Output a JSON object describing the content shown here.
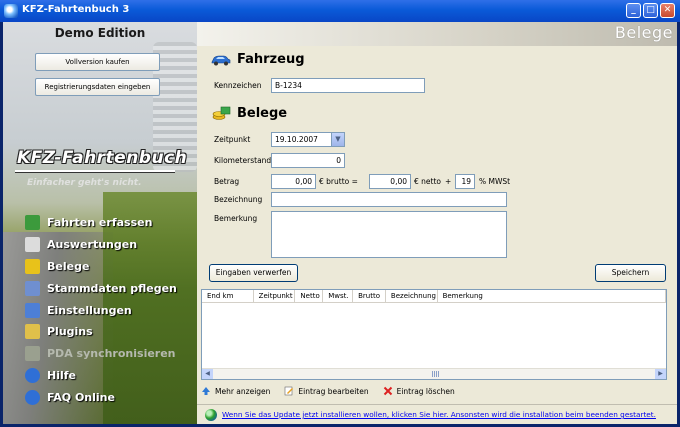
{
  "window": {
    "title": "KFZ-Fahrtenbuch 3",
    "minimize": "_",
    "maximize": "□",
    "close": "✕"
  },
  "sidebar": {
    "edition": "Demo Edition",
    "buy_button": "Vollversion kaufen",
    "register_button": "Registrierungsdaten eingeben",
    "brand": "KFZ-Fahrtenbuch",
    "tagline": "Einfacher geht's nicht.",
    "items": [
      {
        "label": "Fahrten erfassen",
        "icon": "logbook-icon",
        "color": "#3c9a3c"
      },
      {
        "label": "Auswertungen",
        "icon": "printer-icon",
        "color": "#dcdcdc"
      },
      {
        "label": "Belege",
        "icon": "coins-icon",
        "color": "#e8c21a"
      },
      {
        "label": "Stammdaten pflegen",
        "icon": "calendar-icon",
        "color": "#6f8fd0"
      },
      {
        "label": "Einstellungen",
        "icon": "checklist-icon",
        "color": "#4d7fd6"
      },
      {
        "label": "Plugins",
        "icon": "plugin-icon",
        "color": "#e0c04a"
      },
      {
        "label": "PDA synchronisieren",
        "icon": "pda-icon",
        "color": "#9aa08f"
      },
      {
        "label": "Hilfe",
        "icon": "help-icon",
        "color": "#2f6fd6"
      },
      {
        "label": "FAQ Online",
        "icon": "globe-icon",
        "color": "#2f6fd6"
      }
    ]
  },
  "content": {
    "header_title": "Belege",
    "fahrzeug": {
      "title": "Fahrzeug",
      "kennzeichen_label": "Kennzeichen",
      "kennzeichen_value": "B-1234"
    },
    "belege": {
      "title": "Belege",
      "zeitpunkt_label": "Zeitpunkt",
      "zeitpunkt_value": "19.10.2007",
      "kilometerstand_label": "Kilometerstand",
      "kilometerstand_value": "0",
      "betrag_label": "Betrag",
      "brutto_value": "0,00",
      "brutto_label": "€ brutto =",
      "netto_value": "0,00",
      "netto_label": "€ netto",
      "plus": "+",
      "mwst_value": "19",
      "mwst_label": "% MWSt",
      "bezeichnung_label": "Bezeichnung",
      "bezeichnung_value": "",
      "bemerkung_label": "Bemerkung",
      "bemerkung_value": "",
      "discard_button": "Eingaben verwerfen",
      "save_button": "Speichern"
    },
    "table": {
      "columns": [
        {
          "label": "End km",
          "w": 52
        },
        {
          "label": "Zeitpunkt",
          "w": 42
        },
        {
          "label": "Netto",
          "w": 28
        },
        {
          "label": "Mwst.",
          "w": 30
        },
        {
          "label": "Brutto",
          "w": 33
        },
        {
          "label": "Bezeichnung",
          "w": 52
        },
        {
          "label": "Bemerkung",
          "w": 230
        }
      ],
      "rows": []
    },
    "actions": {
      "more": "Mehr anzeigen",
      "edit": "Eintrag bearbeiten",
      "delete": "Eintrag löschen"
    },
    "status": {
      "update_text": "Wenn Sie das Update jetzt installieren wollen, klicken Sie hier. Ansonsten wird die installation beim beenden gestartet."
    }
  }
}
